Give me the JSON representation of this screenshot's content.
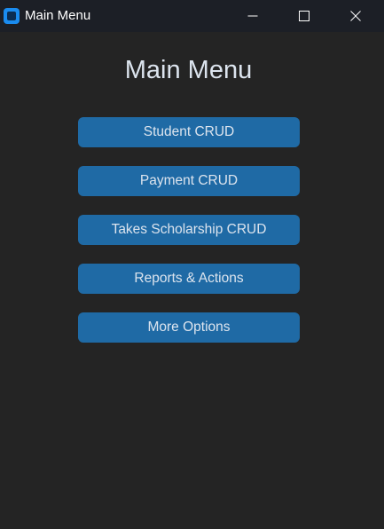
{
  "window": {
    "title": "Main Menu",
    "icon": "app-icon",
    "controls": [
      "minimize-icon",
      "maximize-icon",
      "close-icon"
    ]
  },
  "main": {
    "heading": "Main Menu",
    "buttons": [
      {
        "label": "Student CRUD"
      },
      {
        "label": "Payment CRUD"
      },
      {
        "label": "Takes Scholarship CRUD"
      },
      {
        "label": "Reports & Actions"
      },
      {
        "label": "More Options"
      }
    ]
  },
  "colors": {
    "background": "#242424",
    "titlebar": "#1c1f26",
    "button": "#1f6aa5",
    "text": "#dce4ee",
    "accent": "#1a8cf0"
  }
}
